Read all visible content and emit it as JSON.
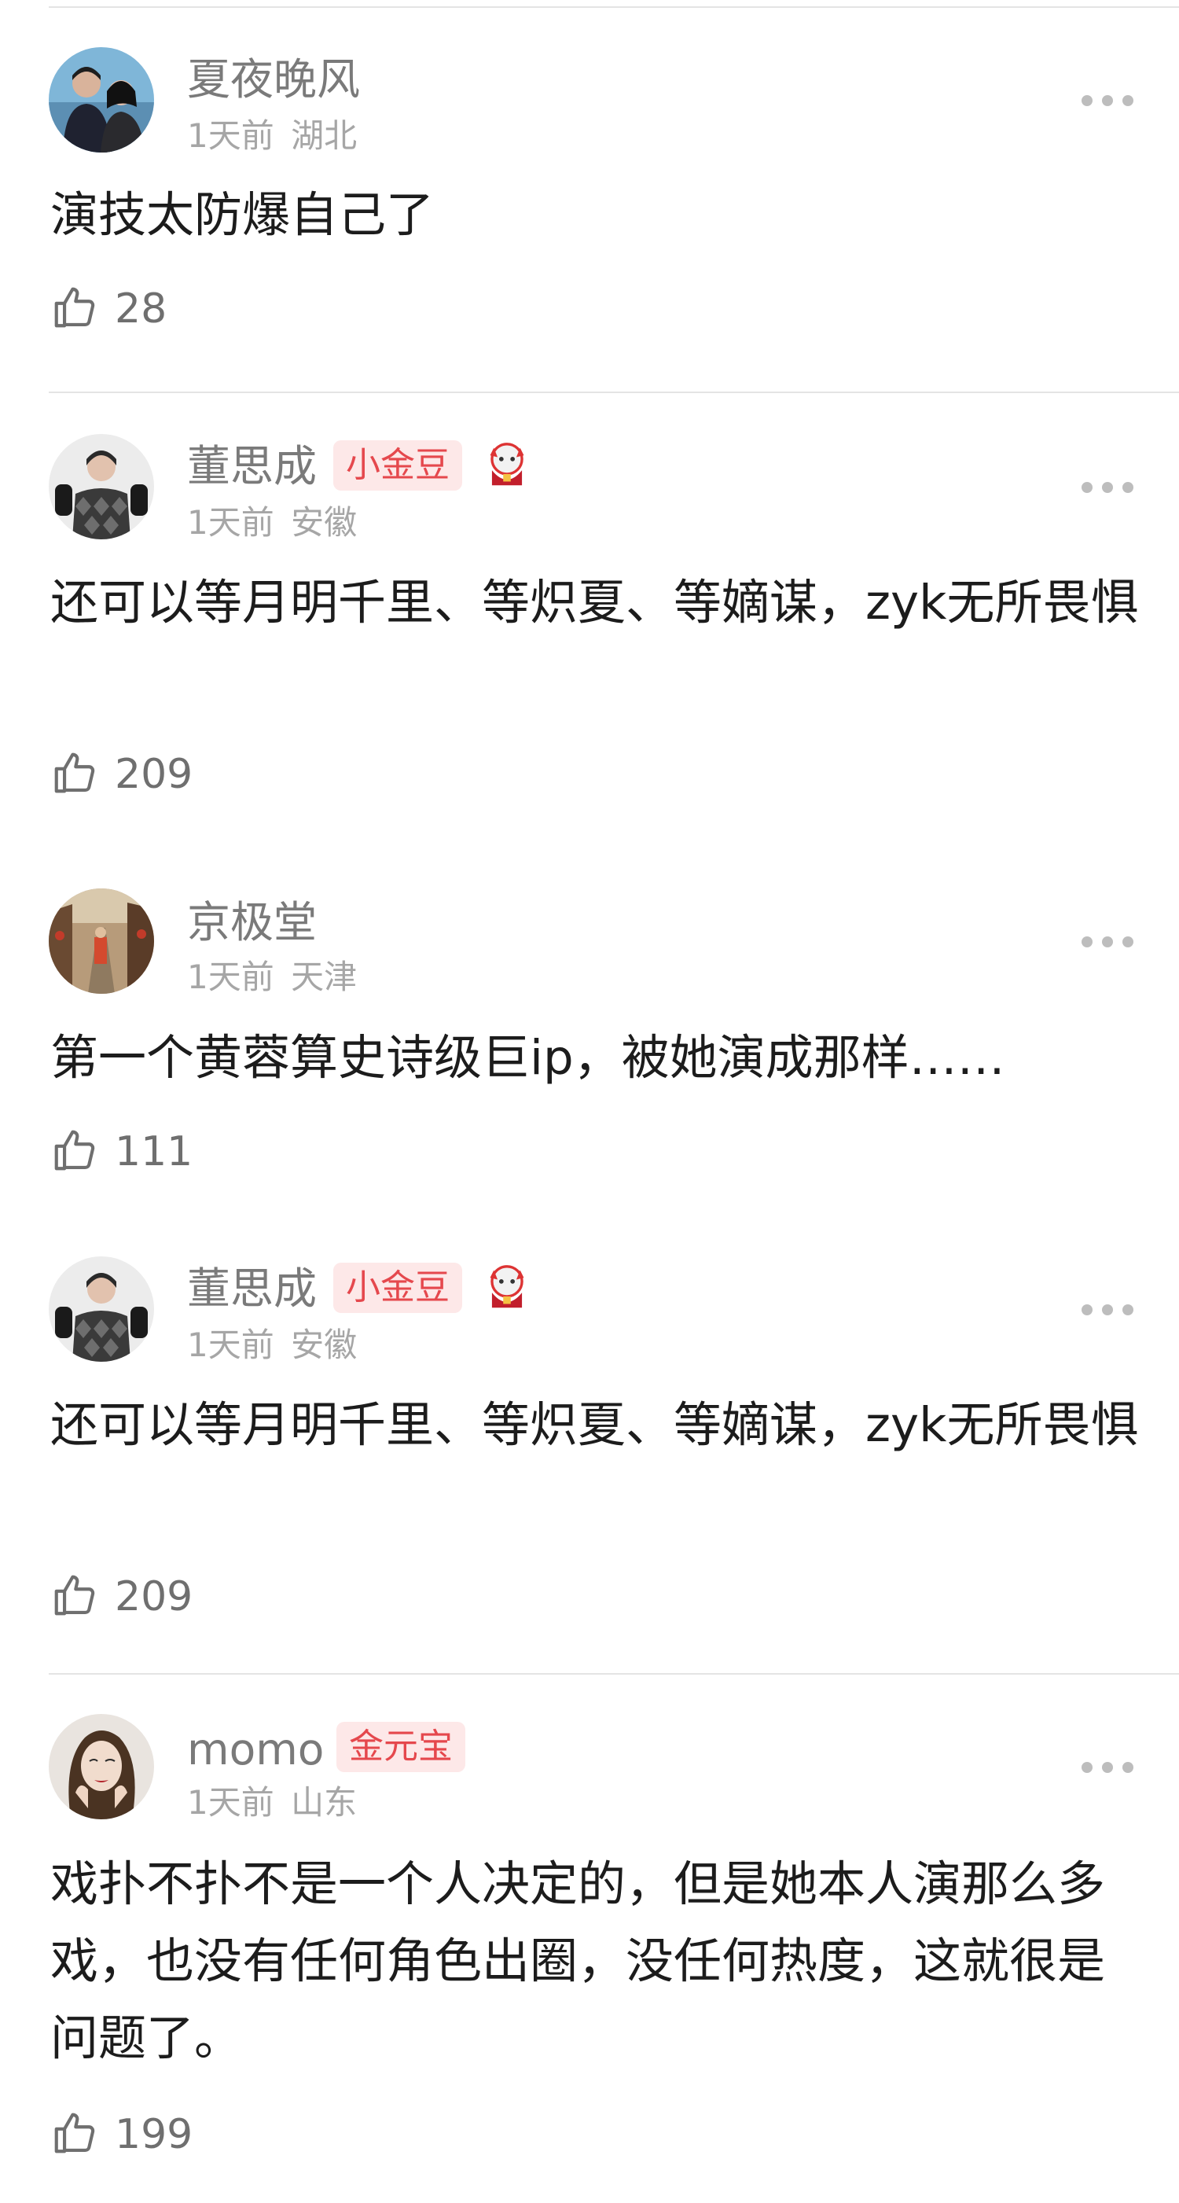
{
  "comments": [
    {
      "username": "夏夜晚风",
      "time": "1天前",
      "location": "湖北",
      "text": "演技太防爆自己了",
      "likes": "28",
      "avatar_icon": "couple-photo-avatar"
    },
    {
      "username": "董思成",
      "badge": "小金豆",
      "time": "1天前",
      "location": "安徽",
      "text": "还可以等月明千里、等炽夏、等嫡谋，zyk无所畏惧",
      "likes": "209",
      "avatar_icon": "man-in-argyle-sweater-avatar",
      "medal_icon": "lucky-cat-medal-icon"
    },
    {
      "username": "京极堂",
      "time": "1天前",
      "location": "天津",
      "text": "第一个黄蓉算史诗级巨ip，被她演成那样……",
      "likes": "111",
      "avatar_icon": "painted-street-avatar"
    },
    {
      "username": "董思成",
      "badge": "小金豆",
      "time": "1天前",
      "location": "安徽",
      "text": "还可以等月明千里、等炽夏、等嫡谋，zyk无所畏惧",
      "likes": "209",
      "avatar_icon": "man-in-argyle-sweater-avatar",
      "medal_icon": "lucky-cat-medal-icon"
    },
    {
      "username": "momo",
      "badge": "金元宝",
      "time": "1天前",
      "location": "山东",
      "text": "戏扑不扑不是一个人决定的，但是她本人演那么多戏，也没有任何角色出圈，没任何热度，这就很是问题了。",
      "likes": "199",
      "avatar_icon": "woman-portrait-avatar"
    }
  ],
  "colors": {
    "badge_bg": "#fde8e8",
    "badge_text": "#e5484d",
    "username": "#7a7a7a",
    "meta": "#a6a6a6",
    "divider": "#e4e4e4"
  }
}
